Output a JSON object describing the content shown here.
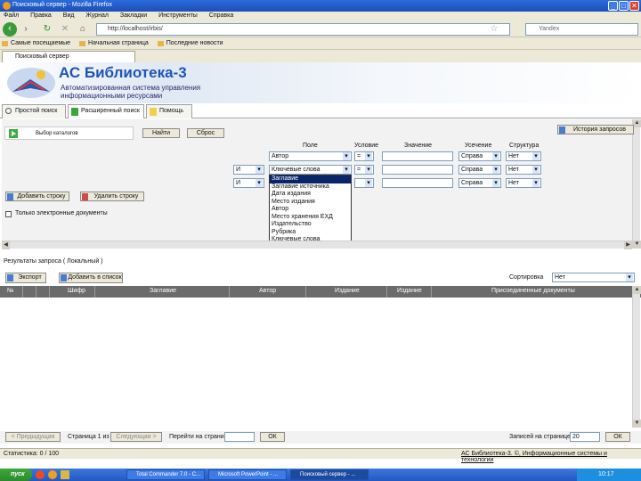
{
  "window": {
    "title": "Поисковый сервер - Mozilla Firefox",
    "min_label": "_",
    "max_label": "□",
    "close_label": "✕"
  },
  "menu": [
    "Файл",
    "Правка",
    "Вид",
    "Журнал",
    "Закладки",
    "Инструменты",
    "Справка"
  ],
  "nav": {
    "back_label": "‹",
    "url": "http://localhost/irbis/",
    "search_placeholder": "Yandex"
  },
  "bookmarks": [
    "Самые посещаемые",
    "Начальная страница",
    "Последние новости"
  ],
  "browser_tab": {
    "label": "Поисковый сервер"
  },
  "header": {
    "app_title": "АС Библиотека-3",
    "subtitle_line1": "Автоматизированная система управления",
    "subtitle_line2": "информационными ресурсами"
  },
  "app_tabs": [
    {
      "label": "Простой поиск"
    },
    {
      "label": "Расширенный поиск"
    },
    {
      "label": "Помощь"
    }
  ],
  "query": {
    "select_label": "Выбор каталогов",
    "find_button": "Найти",
    "reset_button": "Сброс",
    "history_button": "История запросов",
    "columns": {
      "field": "Поле",
      "condition": "Условие",
      "value": "Значение",
      "truncation": "Усечение",
      "structure": "Структура"
    },
    "rows": [
      {
        "logic": "",
        "field": "Автор",
        "cond": "=",
        "value": "",
        "trunc": "Справа",
        "struct": "Нет"
      },
      {
        "logic": "И",
        "field": "Ключевые слова",
        "cond": "=",
        "value": "",
        "trunc": "Справа",
        "struct": "Нет"
      },
      {
        "logic": "И",
        "field": "",
        "cond": "",
        "value": "",
        "trunc": "Справа",
        "struct": "Нет"
      }
    ],
    "dropdown_options": [
      "Заглавие",
      "Заглавие источника",
      "Дата издания",
      "Место издания",
      "Автор",
      "Место хранения ЕХД",
      "Издательство",
      "Рубрика",
      "Ключевые слова"
    ],
    "dropdown_highlight_index": 0,
    "add_row_button": "Добавить строку",
    "remove_row_button": "Удалить строку",
    "checkbox_label": "Только электронные документы"
  },
  "results": {
    "title": "Результаты запроса ( Локальный )",
    "export_button": "Экспорт",
    "add_button": "Добавить в список",
    "sort_label": "Сортировка",
    "sort_value": "Нет",
    "columns": [
      "№",
      "",
      "",
      "Шифр",
      "Заглавие",
      "Автор",
      "Издание",
      "Издание",
      "Присоединенные документы"
    ]
  },
  "pager": {
    "prev_button": "< Предыдущая",
    "page_label": "Страница 1 из",
    "next_button": "Следующая >",
    "goto_label": "Перейти на страницу",
    "goto_button": "ОК",
    "per_page_label": "Записей на странице",
    "per_page_value": "20",
    "per_page_button": "ОК"
  },
  "status": {
    "left": "Статистика: 0 / 100",
    "right": "АС Библиотека-3. ©, Информационные системы и технологии"
  },
  "taskbar": {
    "start_label": "пуск",
    "tasks": [
      "Total Commander 7.0 - C...",
      "Microsoft PowerPoint - ...",
      "Поисковый сервер - ..."
    ],
    "clock": "10:17"
  },
  "colors": {
    "accent": "#1f54b8",
    "grid_header": "#6b6b6b",
    "highlight": "#0a246a"
  }
}
